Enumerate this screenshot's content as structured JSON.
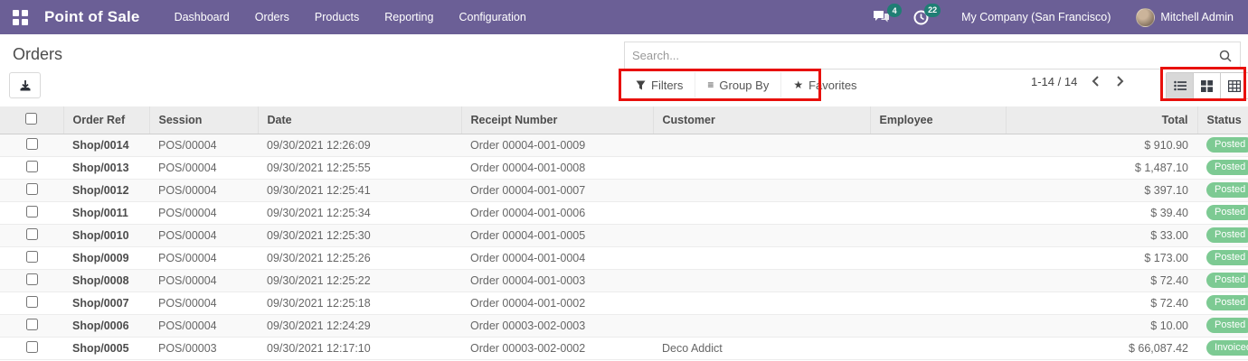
{
  "topbar": {
    "brand": "Point of Sale",
    "menu": [
      "Dashboard",
      "Orders",
      "Products",
      "Reporting",
      "Configuration"
    ],
    "messages_count": "4",
    "activities_count": "22",
    "company": "My Company (San Francisco)",
    "user": "Mitchell Admin"
  },
  "control_panel": {
    "title": "Orders",
    "search_placeholder": "Search...",
    "filters_label": "Filters",
    "group_by_label": "Group By",
    "favorites_label": "Favorites",
    "group_by_glyph": "≡",
    "favorites_glyph": "★",
    "pager_value": "1-14 / 14"
  },
  "icons": {
    "apps": "grid",
    "messages": "chat-bubbles",
    "activities": "clock",
    "export": "download",
    "search": "magnifier",
    "filters": "funnel",
    "view_list": "list",
    "view_kanban": "kanban-squares",
    "view_pivot": "pivot-grid"
  },
  "colors": {
    "topbar_bg": "#6b5f96",
    "systray_badge": "#1f7e74",
    "status_badge": "#7dca93",
    "annotation_red": "#e8100c"
  },
  "table": {
    "headers": [
      "Order Ref",
      "Session",
      "Date",
      "Receipt Number",
      "Customer",
      "Employee",
      "Total",
      "Status"
    ],
    "rows": [
      {
        "order_ref": "Shop/0014",
        "session": "POS/00004",
        "date": "09/30/2021 12:26:09",
        "receipt": "Order 00004-001-0009",
        "customer": "",
        "employee": "",
        "total": "$ 910.90",
        "status": "Posted"
      },
      {
        "order_ref": "Shop/0013",
        "session": "POS/00004",
        "date": "09/30/2021 12:25:55",
        "receipt": "Order 00004-001-0008",
        "customer": "",
        "employee": "",
        "total": "$ 1,487.10",
        "status": "Posted"
      },
      {
        "order_ref": "Shop/0012",
        "session": "POS/00004",
        "date": "09/30/2021 12:25:41",
        "receipt": "Order 00004-001-0007",
        "customer": "",
        "employee": "",
        "total": "$ 397.10",
        "status": "Posted"
      },
      {
        "order_ref": "Shop/0011",
        "session": "POS/00004",
        "date": "09/30/2021 12:25:34",
        "receipt": "Order 00004-001-0006",
        "customer": "",
        "employee": "",
        "total": "$ 39.40",
        "status": "Posted"
      },
      {
        "order_ref": "Shop/0010",
        "session": "POS/00004",
        "date": "09/30/2021 12:25:30",
        "receipt": "Order 00004-001-0005",
        "customer": "",
        "employee": "",
        "total": "$ 33.00",
        "status": "Posted"
      },
      {
        "order_ref": "Shop/0009",
        "session": "POS/00004",
        "date": "09/30/2021 12:25:26",
        "receipt": "Order 00004-001-0004",
        "customer": "",
        "employee": "",
        "total": "$ 173.00",
        "status": "Posted"
      },
      {
        "order_ref": "Shop/0008",
        "session": "POS/00004",
        "date": "09/30/2021 12:25:22",
        "receipt": "Order 00004-001-0003",
        "customer": "",
        "employee": "",
        "total": "$ 72.40",
        "status": "Posted"
      },
      {
        "order_ref": "Shop/0007",
        "session": "POS/00004",
        "date": "09/30/2021 12:25:18",
        "receipt": "Order 00004-001-0002",
        "customer": "",
        "employee": "",
        "total": "$ 72.40",
        "status": "Posted"
      },
      {
        "order_ref": "Shop/0006",
        "session": "POS/00004",
        "date": "09/30/2021 12:24:29",
        "receipt": "Order 00003-002-0003",
        "customer": "",
        "employee": "",
        "total": "$ 10.00",
        "status": "Posted"
      },
      {
        "order_ref": "Shop/0005",
        "session": "POS/00003",
        "date": "09/30/2021 12:17:10",
        "receipt": "Order 00003-002-0002",
        "customer": "Deco Addict",
        "employee": "",
        "total": "$ 66,087.42",
        "status": "Invoiced"
      }
    ]
  }
}
